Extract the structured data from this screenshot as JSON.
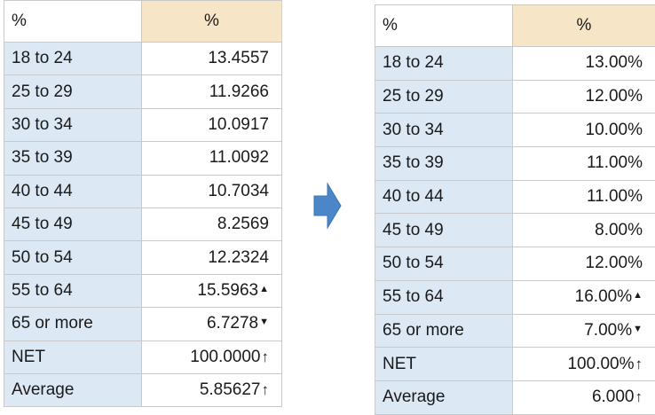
{
  "left_table": {
    "header": {
      "label": "%",
      "value": "%"
    },
    "rows": [
      {
        "label": "18 to 24",
        "value": "13.4557"
      },
      {
        "label": "25 to 29",
        "value": "11.9266"
      },
      {
        "label": "30 to 34",
        "value": "10.0917"
      },
      {
        "label": "35 to 39",
        "value": "11.0092"
      },
      {
        "label": "40 to 44",
        "value": "10.7034"
      },
      {
        "label": "45 to 49",
        "value": "8.2569"
      },
      {
        "label": "50 to 54",
        "value": "12.2324"
      },
      {
        "label": "55 to 64",
        "value": "15.5963",
        "indicator": "up-small",
        "color": "#1414ff"
      },
      {
        "label": "65 or more",
        "value": "6.7278",
        "indicator": "down-small",
        "color": "#f00000"
      },
      {
        "label": "NET",
        "value": "100.0000",
        "indicator": "up-arrow",
        "color": "#1414ff"
      },
      {
        "label": "Average",
        "value": "5.85627",
        "indicator": "up-arrow",
        "color": "#1414ff"
      }
    ]
  },
  "right_table": {
    "header": {
      "label": "%",
      "value": "%"
    },
    "rows": [
      {
        "label": "18 to 24",
        "value": "13.00%"
      },
      {
        "label": "25 to 29",
        "value": "12.00%"
      },
      {
        "label": "30 to 34",
        "value": "10.00%"
      },
      {
        "label": "35 to 39",
        "value": "11.00%"
      },
      {
        "label": "40 to 44",
        "value": "11.00%"
      },
      {
        "label": "45 to 49",
        "value": "8.00%"
      },
      {
        "label": "50 to 54",
        "value": "12.00%"
      },
      {
        "label": "55 to 64",
        "value": "16.00%",
        "indicator": "up-small",
        "color": "#1414ff"
      },
      {
        "label": "65 or more",
        "value": "7.00%",
        "indicator": "down-small",
        "color": "#f00000"
      },
      {
        "label": "NET",
        "value": "100.00%",
        "indicator": "up-arrow",
        "color": "#1414ff"
      },
      {
        "label": "Average",
        "value": "6.000",
        "indicator": "up-arrow",
        "color": "#1414ff"
      }
    ]
  },
  "transition_arrow": {
    "icon": "arrow-right-icon",
    "color": "#4a86c8"
  },
  "colors": {
    "header_fill": "#f6e5c7",
    "label_fill": "#dde8f5",
    "grid_line": "#c9c9c9",
    "significant_up": "#1414ff",
    "significant_down": "#f00000"
  }
}
